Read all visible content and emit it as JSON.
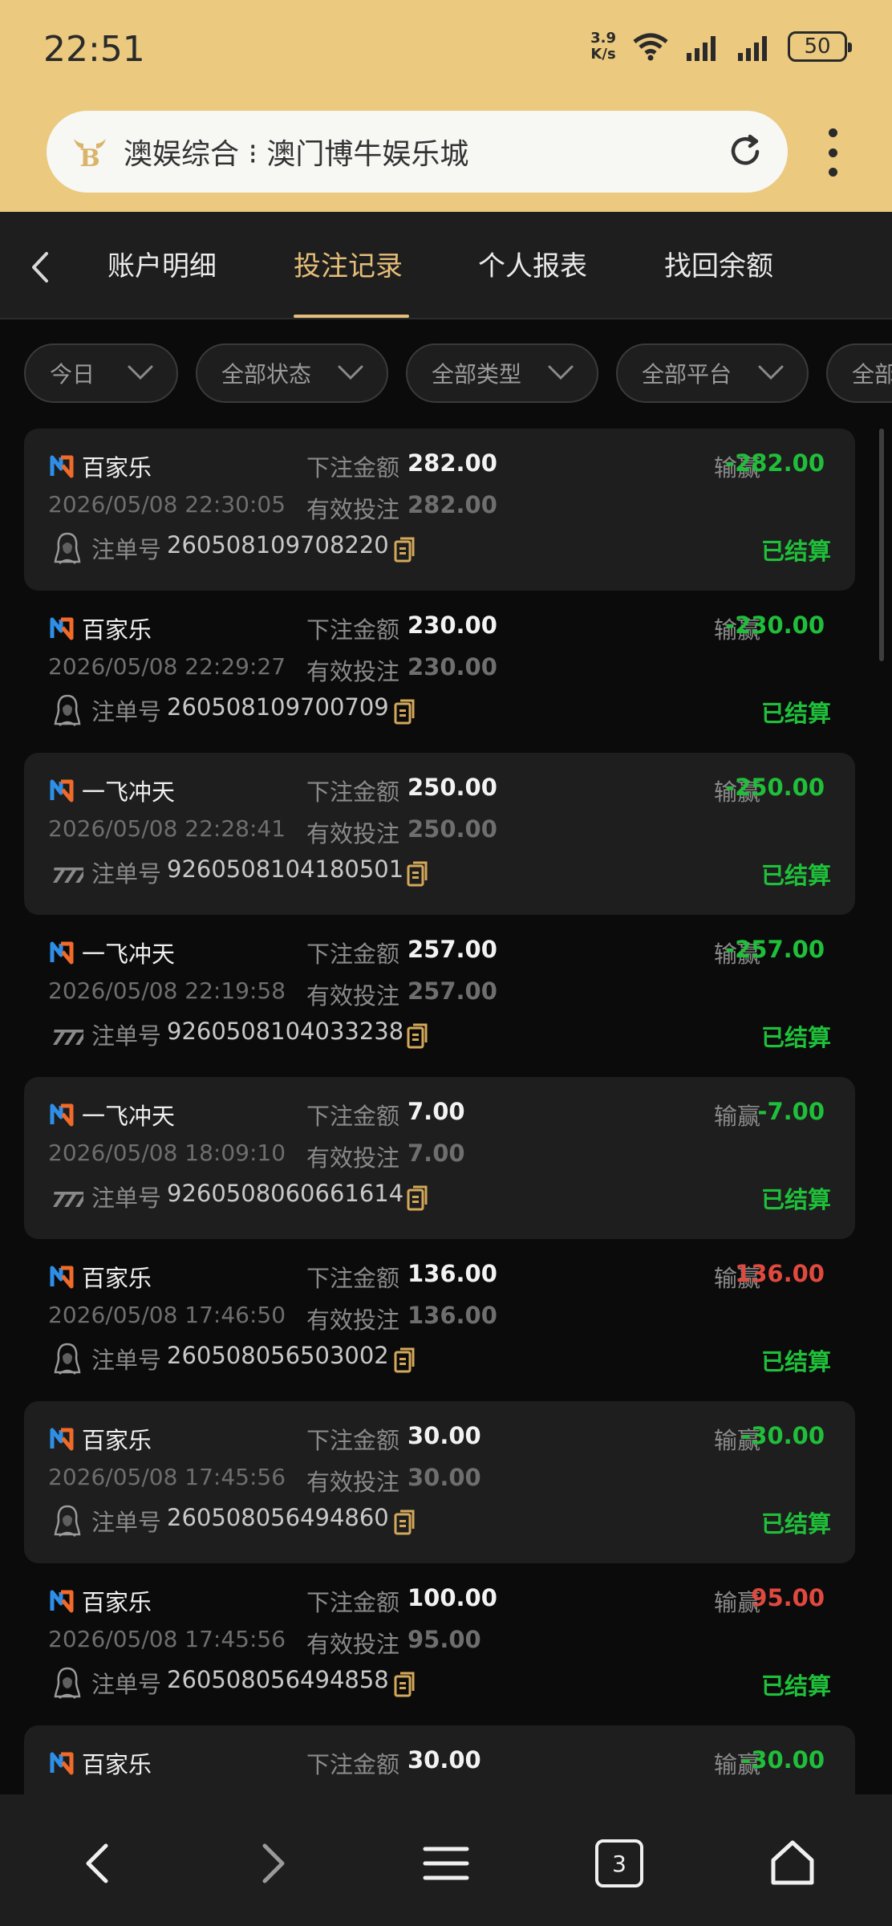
{
  "status_bar": {
    "time": "22:51",
    "speed_value": "3.9",
    "speed_unit": "K/s",
    "battery": "50",
    "icons": [
      "wifi-icon",
      "signal-icon",
      "signal-icon",
      "battery-icon"
    ]
  },
  "browser": {
    "title": "澳娱综合 ⁝ 澳门博牛娱乐城",
    "icons": [
      "bull-logo-icon",
      "reload-icon",
      "more-vert-icon"
    ]
  },
  "tabs": [
    {
      "label": "账户明细",
      "active": false
    },
    {
      "label": "投注记录",
      "active": true
    },
    {
      "label": "个人报表",
      "active": false
    },
    {
      "label": "找回余额",
      "active": false
    }
  ],
  "filters": [
    {
      "label": "今日"
    },
    {
      "label": "全部状态"
    },
    {
      "label": "全部类型"
    },
    {
      "label": "全部平台"
    },
    {
      "label": "全部"
    }
  ],
  "labels": {
    "bet_amount": "下注金额",
    "valid_bet": "有效投注",
    "win_loss": "输赢",
    "order_no": "注单号"
  },
  "records": [
    {
      "game": "百家乐",
      "datetime": "2026/05/08 22:30:05",
      "bet": "282.00",
      "valid": "282.00",
      "winloss": "-282.00",
      "order": "260508109708220",
      "status": "已结算",
      "avatar_icon": "dealer-avatar-icon",
      "positive": false,
      "shaded": true
    },
    {
      "game": "百家乐",
      "datetime": "2026/05/08 22:29:27",
      "bet": "230.00",
      "valid": "230.00",
      "winloss": "-230.00",
      "order": "260508109700709",
      "status": "已结算",
      "avatar_icon": "dealer-avatar-icon",
      "positive": false,
      "shaded": false
    },
    {
      "game": "一飞冲天",
      "datetime": "2026/05/08 22:28:41",
      "bet": "250.00",
      "valid": "250.00",
      "winloss": "-250.00",
      "order": "9260508104180501",
      "status": "已结算",
      "avatar_icon": "slot-777-icon",
      "positive": false,
      "shaded": true
    },
    {
      "game": "一飞冲天",
      "datetime": "2026/05/08 22:19:58",
      "bet": "257.00",
      "valid": "257.00",
      "winloss": "-257.00",
      "order": "9260508104033238",
      "status": "已结算",
      "avatar_icon": "slot-777-icon",
      "positive": false,
      "shaded": false
    },
    {
      "game": "一飞冲天",
      "datetime": "2026/05/08 18:09:10",
      "bet": "7.00",
      "valid": "7.00",
      "winloss": "-7.00",
      "order": "9260508060661614",
      "status": "已结算",
      "avatar_icon": "slot-777-icon",
      "positive": false,
      "shaded": true
    },
    {
      "game": "百家乐",
      "datetime": "2026/05/08 17:46:50",
      "bet": "136.00",
      "valid": "136.00",
      "winloss": "136.00",
      "order": "260508056503002",
      "status": "已结算",
      "avatar_icon": "dealer-avatar-icon",
      "positive": true,
      "shaded": false
    },
    {
      "game": "百家乐",
      "datetime": "2026/05/08 17:45:56",
      "bet": "30.00",
      "valid": "30.00",
      "winloss": "-30.00",
      "order": "260508056494860",
      "status": "已结算",
      "avatar_icon": "dealer-avatar-icon",
      "positive": false,
      "shaded": true
    },
    {
      "game": "百家乐",
      "datetime": "2026/05/08 17:45:56",
      "bet": "100.00",
      "valid": "95.00",
      "winloss": "95.00",
      "order": "260508056494858",
      "status": "已结算",
      "avatar_icon": "dealer-avatar-icon",
      "positive": true,
      "shaded": false
    },
    {
      "game": "百家乐",
      "datetime": "",
      "bet": "30.00",
      "valid": "",
      "winloss": "-30.00",
      "order": "",
      "status": "",
      "avatar_icon": "dealer-avatar-icon",
      "positive": false,
      "shaded": true
    }
  ],
  "bottom_nav": {
    "tab_count": "3",
    "icons": [
      "back-arrow-icon",
      "forward-arrow-icon",
      "menu-icon",
      "tabs-icon",
      "home-icon"
    ]
  },
  "colors": {
    "accent_gold": "#e5be79",
    "status_bar_bg": "#ebc97f",
    "loss_green": "#1fbf3a",
    "win_red": "#e0493e"
  }
}
